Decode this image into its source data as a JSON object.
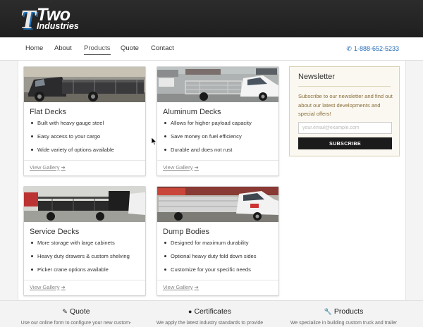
{
  "brand": {
    "logo_letter": "T",
    "logo_word": "Two",
    "logo_sub": "Industries"
  },
  "nav": {
    "items": [
      "Home",
      "About",
      "Products",
      "Quote",
      "Contact"
    ],
    "active": "Products",
    "phone": "1-888-652-5233"
  },
  "cards": [
    {
      "title": "Flat Decks",
      "bullets": [
        "Built with heavy gauge steel",
        "Easy access to your cargo",
        "Wide variety of options available"
      ],
      "link": "View Gallery"
    },
    {
      "title": "Aluminum Decks",
      "bullets": [
        "Allows for higher payload capacity",
        "Save money on fuel efficiency",
        "Durable and does not rust"
      ],
      "link": "View Gallery"
    },
    {
      "title": "Service Decks",
      "bullets": [
        "More storage with large cabinets",
        "Heavy duty drawers & custom shelving",
        "Picker crane options available"
      ],
      "link": "View Gallery"
    },
    {
      "title": "Dump Bodies",
      "bullets": [
        "Designed for maximum durability",
        "Optional heavy duty fold down sides",
        "Customize for your specific needs"
      ],
      "link": "View Gallery"
    }
  ],
  "newsletter": {
    "title": "Newsletter",
    "text": "Subscribe to our newsletter and find out about our latest developments and special offers!",
    "placeholder": "your.email@example.com",
    "button": "SUBSCRIBE"
  },
  "footer": [
    {
      "icon": "edit-icon",
      "title": "Quote",
      "text": "Use our online form to configure your new custom-"
    },
    {
      "icon": "certificate-icon",
      "title": "Certificates",
      "text": "We apply the latest industry standards to provide"
    },
    {
      "icon": "wrench-icon",
      "title": "Products",
      "text": "We specialize in building custom truck and trailer"
    }
  ],
  "colors": {
    "header_bg": "#222222",
    "link_blue": "#1e66b5",
    "newsletter_bg": "#faf8f0",
    "newsletter_text": "#8a6d3b"
  }
}
